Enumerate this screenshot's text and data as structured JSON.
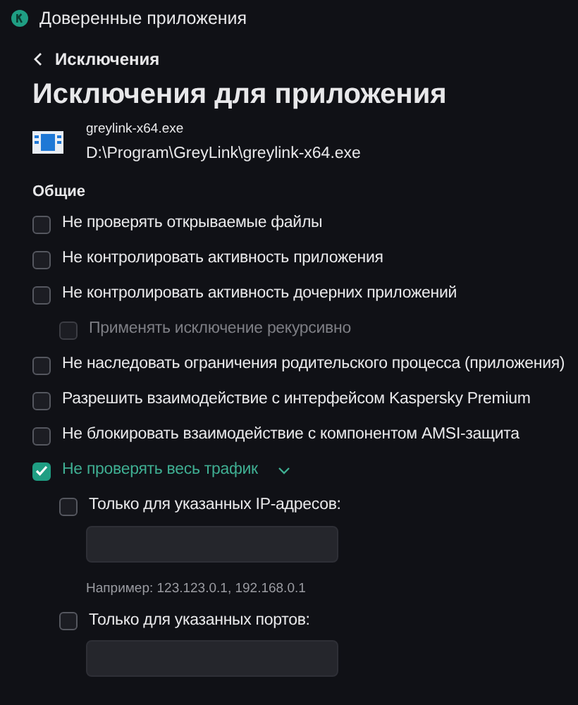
{
  "window": {
    "title": "Доверенные приложения"
  },
  "back_link": "Исключения",
  "heading": "Исключения для приложения",
  "file": {
    "name": "greylink-x64.exe",
    "path": "D:\\Program\\GreyLink\\greylink-x64.exe"
  },
  "section": "Общие",
  "options": [
    {
      "kind": "checkbox",
      "label": "Не проверять открываемые файлы",
      "checked": false,
      "disabled": false
    },
    {
      "kind": "checkbox",
      "label": "Не контролировать активность приложения",
      "checked": false,
      "disabled": false
    },
    {
      "kind": "checkbox",
      "label": "Не контролировать активность дочерних приложений",
      "checked": false,
      "disabled": false,
      "children": [
        {
          "kind": "checkbox",
          "label": "Применять исключение рекурсивно",
          "checked": false,
          "disabled": true
        }
      ]
    },
    {
      "kind": "checkbox",
      "label": "Не наследовать ограничения родительского процесса (приложения)",
      "checked": false,
      "disabled": false
    },
    {
      "kind": "checkbox",
      "label": "Разрешить взаимодействие с интерфейсом Kaspersky Premium",
      "checked": false,
      "disabled": false
    },
    {
      "kind": "checkbox",
      "label": "Не блокировать взаимодействие с компонентом AMSI-защита",
      "checked": false,
      "disabled": false
    },
    {
      "kind": "checkbox",
      "label": "Не проверять весь трафик",
      "checked": true,
      "disabled": false,
      "expanded": true,
      "children": [
        {
          "kind": "checkbox",
          "label": "Только для указанных IP-адресов:",
          "checked": false,
          "disabled": false
        },
        {
          "kind": "field"
        },
        {
          "kind": "hint",
          "text": "Например: 123.123.0.1, 192.168.0.1"
        },
        {
          "kind": "checkbox",
          "label": "Только для указанных портов:",
          "checked": false,
          "disabled": false
        },
        {
          "kind": "field"
        }
      ]
    }
  ]
}
